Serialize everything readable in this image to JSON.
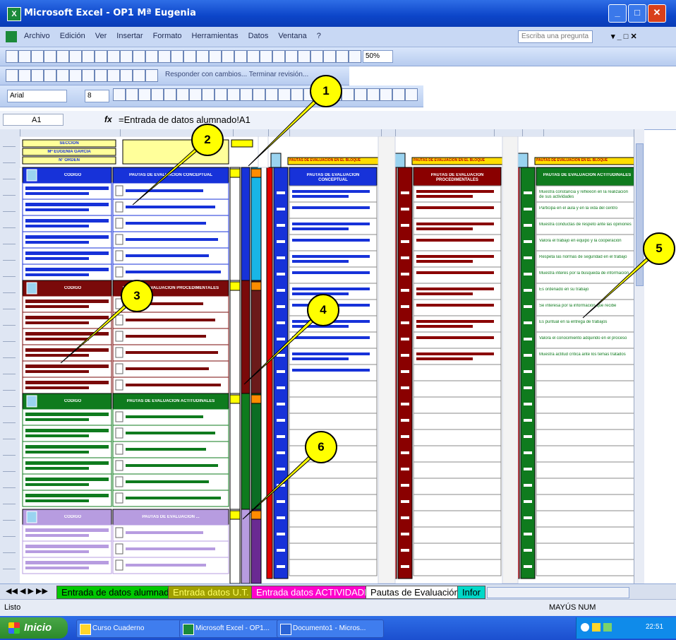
{
  "window": {
    "title": "Microsoft Excel - OP1 Mª Eugenia",
    "app_icon": "excel-icon"
  },
  "menu": {
    "items": [
      "Archivo",
      "Edición",
      "Ver",
      "Insertar",
      "Formato",
      "Herramientas",
      "Datos",
      "Ventana",
      "?"
    ],
    "help_placeholder": "Escriba una pregunta"
  },
  "toolbar": {
    "zoom": "50%",
    "review_text": "Responder con cambios... Terminar revisión..."
  },
  "format_bar": {
    "font": "Arial",
    "size": "8"
  },
  "formula_bar": {
    "cell_ref": "A1",
    "fx": "fx",
    "content": "=Entrada de datos alumnado!A1"
  },
  "sheet": {
    "left_headers": [
      "SECCIÓN",
      "Mª EUGENIA GARCÍA",
      "Nº ORDEN"
    ],
    "blocks": [
      {
        "code_header": "CÓDIGO",
        "title": "PAUTAS DE EVALUACIÓN CONCEPTUAL",
        "color": "#1732d9"
      },
      {
        "code_header": "CÓDIGO",
        "title": "PAUTAS DE EVALUACIÓN PROCEDIMENTALES",
        "color": "#7a0a0a"
      },
      {
        "code_header": "CÓDIGO",
        "title": "PAUTAS DE EVALUACIÓN ACTITUDINALES",
        "color": "#0f7b1e"
      },
      {
        "code_header": "CÓDIGO",
        "title": "PAUTAS DE EVALUACIÓN ...",
        "color": "#b79ce0"
      }
    ],
    "panels": [
      {
        "header": "PAUTAS DE EVALUACIÓN CONCEPTUAL",
        "banner": "PAUTAS DE EVALUACIÓN EN EL BLOQUE",
        "color": "#1732d9"
      },
      {
        "header": "PAUTAS DE EVALUACIÓN PROCEDIMENTALES",
        "banner": "PAUTAS DE EVALUACIÓN EN EL BLOQUE",
        "color": "#8a0000"
      },
      {
        "header": "PAUTAS DE EVALUACIÓN ACTITUDINALES",
        "banner": "PAUTAS DE EVALUACIÓN EN EL BLOQUE",
        "color": "#0f7b1e"
      }
    ],
    "green_list": [
      "Muestra constancia y reflexión en la realización de sus actividades",
      "Participa en el aula y en la vida del centro",
      "Muestra conductas de respeto ante las opiniones",
      "Valora el trabajo en equipo y la cooperación",
      "Respeta las normas de seguridad en el trabajo",
      "Muestra interés por la búsqueda de información",
      "Es ordenado en su trabajo",
      "Se interesa por la información que recibe",
      "Es puntual en la entrega de trabajos",
      "Valora el conocimiento adquirido en el proceso",
      "Muestra actitud crítica ante los temas tratados"
    ]
  },
  "sheet_tabs": [
    {
      "label": "Entrada de datos alumnado",
      "bg": "#00c800",
      "fg": "#000000"
    },
    {
      "label": "Entrada datos U.T.",
      "bg": "#a0a000",
      "fg": "#ffff66"
    },
    {
      "label": "Entrada datos ACTIVIDADES",
      "bg": "#ff00cc",
      "fg": "#ffffff"
    },
    {
      "label": "Pautas de Evaluación",
      "bg": "#ffffff",
      "fg": "#000000"
    },
    {
      "label": "Infor",
      "bg": "#00d8c8",
      "fg": "#000000"
    }
  ],
  "status": {
    "left": "Listo",
    "right": "MAYÚS NUM"
  },
  "taskbar": {
    "start": "Inicio",
    "buttons": [
      "Curso Cuaderno",
      "Microsoft Excel - OP1...",
      "Documento1 - Micros..."
    ],
    "clock": "22:51"
  },
  "callouts": [
    "1",
    "2",
    "3",
    "4",
    "5",
    "6"
  ],
  "colors": {
    "blue": "#1732d9",
    "maroon": "#7a0a0a",
    "green": "#0f7b1e",
    "purple": "#b79ce0",
    "red": "#e00000",
    "yellow": "#ffff00"
  }
}
